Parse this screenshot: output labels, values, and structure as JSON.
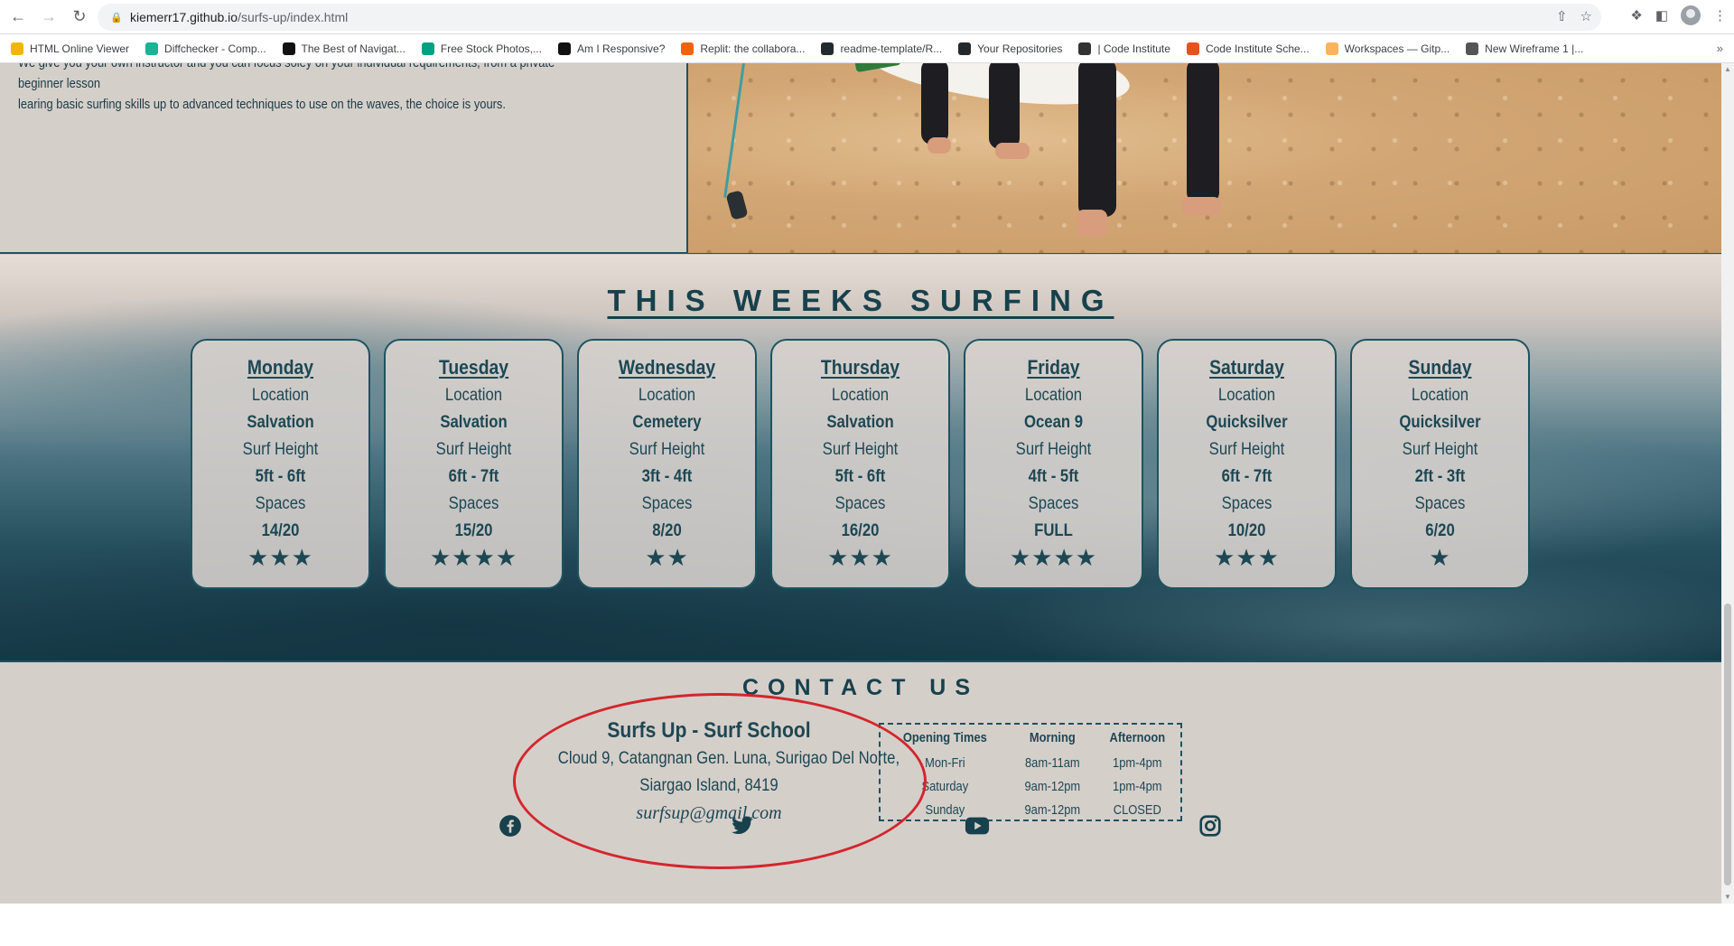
{
  "browser": {
    "url_host": "kiemerr17.github.io",
    "url_path": "/surfs-up/index.html",
    "bookmarks": [
      {
        "label": "HTML Online Viewer",
        "color": "#f2b600"
      },
      {
        "label": "Diffchecker - Comp...",
        "color": "#1ab394"
      },
      {
        "label": "The Best of Navigat...",
        "color": "#111111"
      },
      {
        "label": "Free Stock Photos,...",
        "color": "#05a081"
      },
      {
        "label": "Am I Responsive?",
        "color": "#111111"
      },
      {
        "label": "Replit: the collabora...",
        "color": "#f26207"
      },
      {
        "label": "readme-template/R...",
        "color": "#24292e"
      },
      {
        "label": "Your Repositories",
        "color": "#24292e"
      },
      {
        "label": "| Code Institute",
        "color": "#333333"
      },
      {
        "label": "Code Institute Sche...",
        "color": "#e8501c"
      },
      {
        "label": "Workspaces — Gitp...",
        "color": "#ffb45b"
      },
      {
        "label": "New Wireframe 1 |...",
        "color": "#555555"
      }
    ],
    "more": "»"
  },
  "about": {
    "line1": "We give you your own instructor and you can focus soley on your individual requirements, from a private beginner lesson",
    "line2": "learing basic surfing skills up to advanced techniques to use on the waves, the choice is yours."
  },
  "surfing": {
    "title": "THIS WEEKS SURFING",
    "location_label": "Location",
    "height_label": "Surf Height",
    "spaces_label": "Spaces",
    "days": [
      {
        "name": "Monday",
        "location": "Salvation",
        "height": "5ft - 6ft",
        "spaces": "14/20",
        "rating": 3,
        "stars": "★★★"
      },
      {
        "name": "Tuesday",
        "location": "Salvation",
        "height": "6ft - 7ft",
        "spaces": "15/20",
        "rating": 4,
        "stars": "★★★★"
      },
      {
        "name": "Wednesday",
        "location": "Cemetery",
        "height": "3ft - 4ft",
        "spaces": "8/20",
        "rating": 2,
        "stars": "★★"
      },
      {
        "name": "Thursday",
        "location": "Salvation",
        "height": "5ft - 6ft",
        "spaces": "16/20",
        "rating": 3,
        "stars": "★★★"
      },
      {
        "name": "Friday",
        "location": "Ocean 9",
        "height": "4ft - 5ft",
        "spaces": "FULL",
        "rating": 4,
        "stars": "★★★★"
      },
      {
        "name": "Saturday",
        "location": "Quicksilver",
        "height": "6ft - 7ft",
        "spaces": "10/20",
        "rating": 3,
        "stars": "★★★"
      },
      {
        "name": "Sunday",
        "location": "Quicksilver",
        "height": "2ft - 3ft",
        "spaces": "6/20",
        "rating": 1,
        "stars": "★"
      }
    ]
  },
  "contact": {
    "title": "CONTACT US",
    "business_name": "Surfs Up - Surf School",
    "address_line1": "Cloud 9, Catangnan Gen. Luna, Surigao Del Norte,",
    "address_line2": "Siargao Island, 8419",
    "email": "surfsup@gmail.com",
    "hours": {
      "headers": [
        "Opening Times",
        "Morning",
        "Afternoon"
      ],
      "rows": [
        [
          "Mon-Fri",
          "8am-11am",
          "1pm-4pm"
        ],
        [
          "Saturday",
          "9am-12pm",
          "1pm-4pm"
        ],
        [
          "Sunday",
          "9am-12pm",
          "CLOSED"
        ]
      ]
    },
    "socials": [
      "facebook-icon",
      "twitter-icon",
      "youtube-icon",
      "instagram-icon"
    ],
    "accent_color": "#17414c"
  },
  "annotation": {
    "color": "#d3262d"
  }
}
